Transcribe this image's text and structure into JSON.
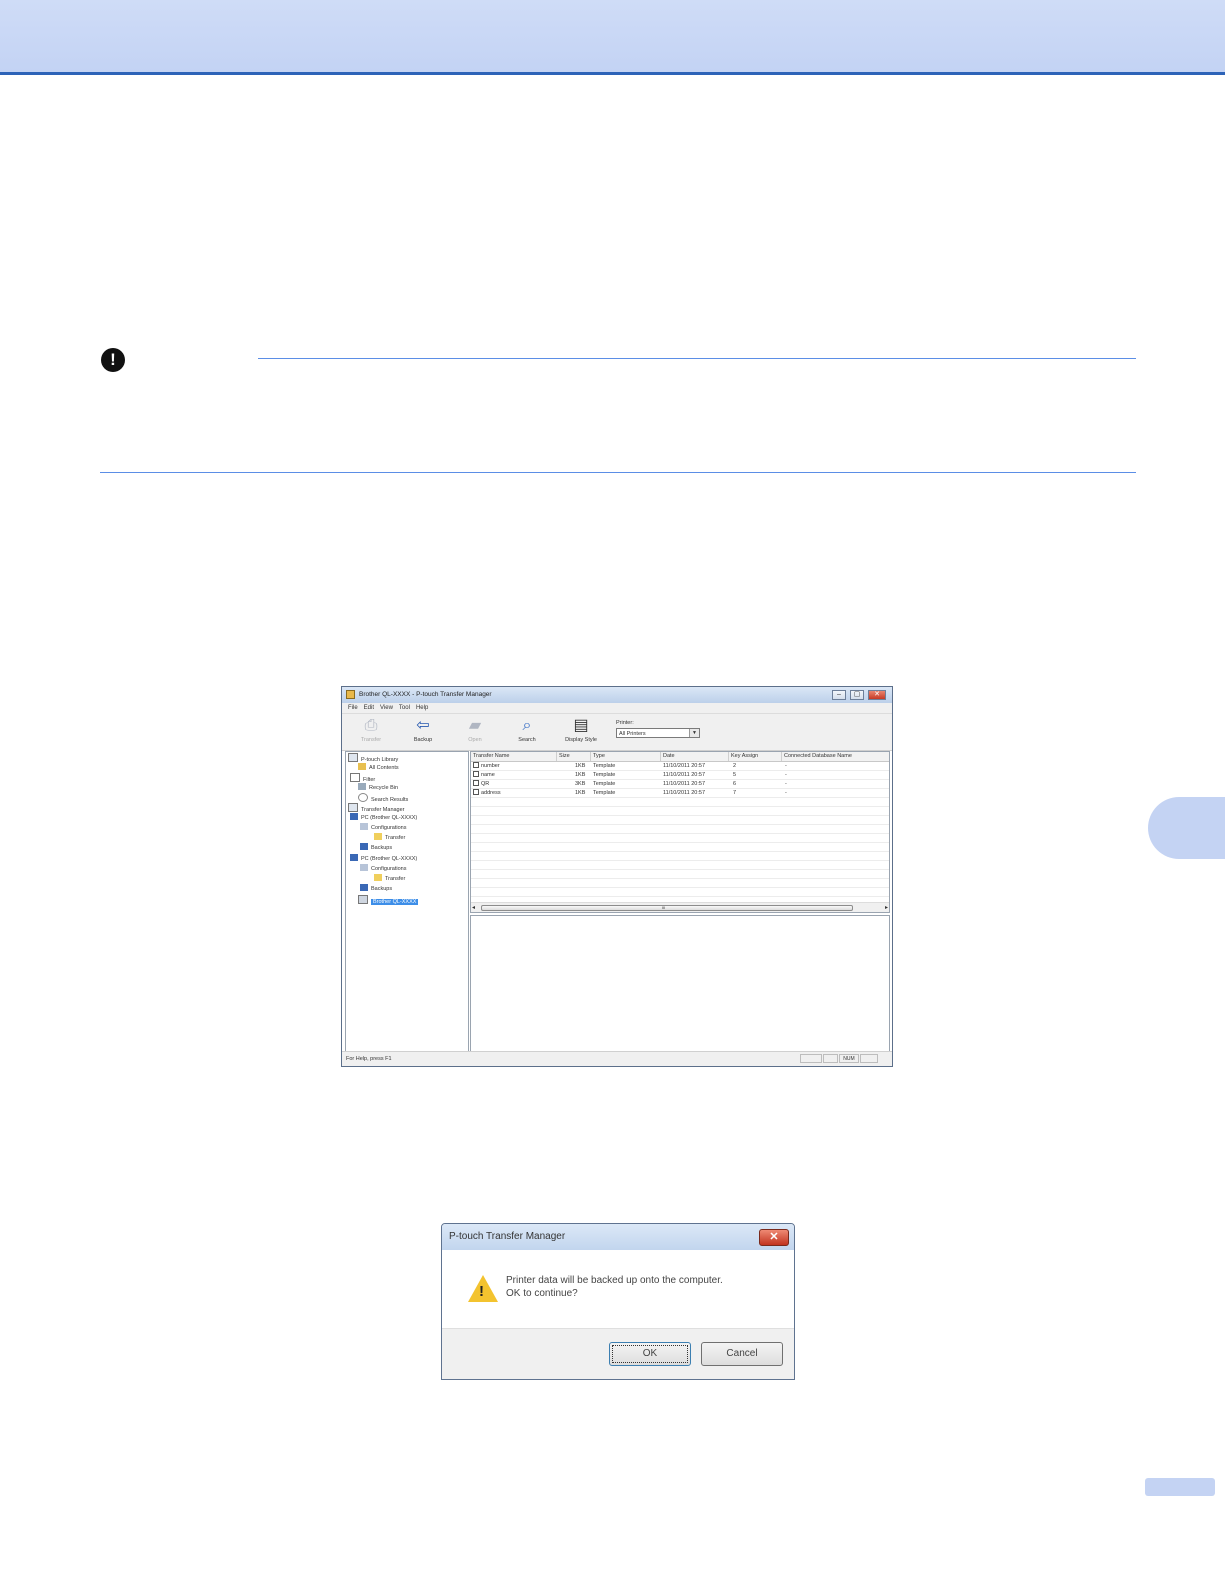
{
  "note": {
    "icon": "exclamation-icon",
    "glyph": "!"
  },
  "app_window": {
    "title": "Brother QL-XXXX - P-touch Transfer Manager",
    "controls": [
      "–",
      "▢",
      "✕"
    ],
    "menu": [
      "File",
      "Edit",
      "View",
      "Tool",
      "Help"
    ],
    "toolbar": {
      "transfer": "Transfer",
      "backup": "Backup",
      "open": "Open",
      "search": "Search",
      "display_style": "Display Style",
      "printer_label": "Printer:",
      "printer_value": "All Printers",
      "printer_arrow": "▼"
    },
    "tree": [
      "P-touch Library",
      "All Contents",
      "Filter",
      "Recycle Bin",
      "Search Results",
      "Transfer Manager",
      "PC (Brother QL-XXXX)",
      "Configurations",
      "Transfer",
      "Backups",
      "PC (Brother QL-XXXX)",
      "Configurations",
      "Transfer",
      "Backups",
      "Brother QL-XXXX"
    ],
    "table": {
      "headers": [
        "Transfer Name",
        "Size",
        "Type",
        "Date",
        "Key Assign",
        "Connected Database Name"
      ],
      "rows": [
        [
          "number",
          "1KB",
          "Template",
          "11/10/2011 20:57",
          "2",
          "-"
        ],
        [
          "name",
          "1KB",
          "Template",
          "11/10/2011 20:57",
          "5",
          "-"
        ],
        [
          "QR",
          "3KB",
          "Template",
          "11/10/2011 20:57",
          "6",
          "-"
        ],
        [
          "address",
          "1KB",
          "Template",
          "11/10/2011 20:57",
          "7",
          "-"
        ]
      ]
    },
    "scroll_left": "◂",
    "scroll_right": "▸",
    "scroll_grip": "III",
    "status": "For Help, press F1",
    "status_num": "NUM"
  },
  "dialog": {
    "title": "P-touch Transfer Manager",
    "close": "✕",
    "message_line1": "Printer data will be backed up onto the computer.",
    "message_line2": "OK to continue?",
    "warning_glyph": "!",
    "ok": "OK",
    "cancel": "Cancel"
  },
  "colors": {
    "band": "#c8d7f5",
    "rule": "#5b8ee6",
    "accent": "#2d63b8"
  }
}
